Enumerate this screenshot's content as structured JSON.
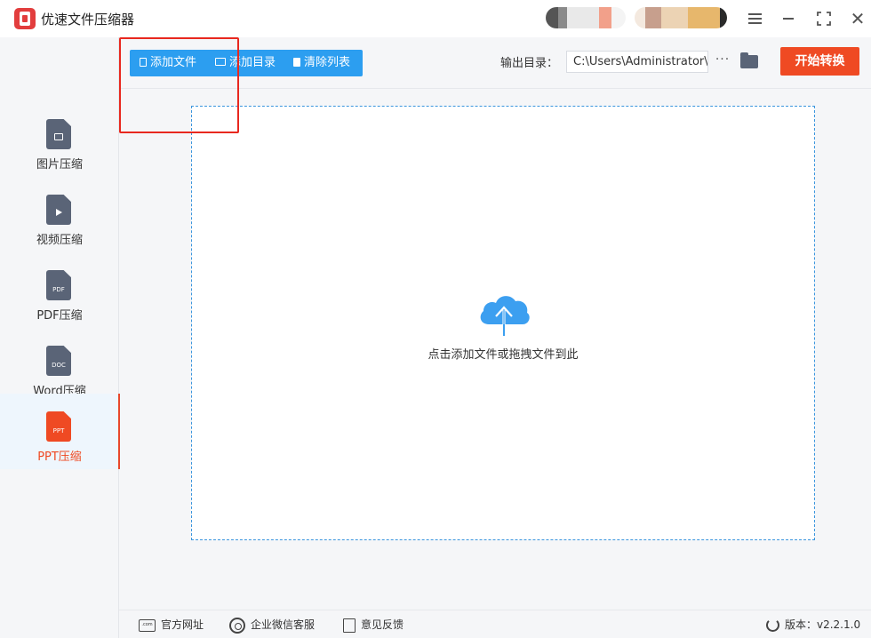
{
  "app": {
    "title": "优速文件压缩器"
  },
  "window": {
    "menu_icon": "menu-icon",
    "minimize_icon": "minimize-icon",
    "maximize_icon": "maximize-icon",
    "close_glyph": "✕"
  },
  "sidebar": {
    "items": [
      {
        "label": "图片压缩",
        "icon": "image-file-icon",
        "tag": ""
      },
      {
        "label": "视频压缩",
        "icon": "video-file-icon",
        "tag": ""
      },
      {
        "label": "PDF压缩",
        "icon": "pdf-file-icon",
        "tag": "PDF"
      },
      {
        "label": "Word压缩",
        "icon": "doc-file-icon",
        "tag": "DOC"
      },
      {
        "label": "PPT压缩",
        "icon": "ppt-file-icon",
        "tag": "PPT",
        "active": true
      }
    ]
  },
  "toolbar": {
    "add_file": "添加文件",
    "add_folder": "添加目录",
    "clear_list": "清除列表",
    "output_label": "输出目录：",
    "output_path": "C:\\Users\\Administrator\\",
    "more": "···",
    "start": "开始转换"
  },
  "dropzone": {
    "text": "点击添加文件或拖拽文件到此"
  },
  "footer": {
    "website": "官方网址",
    "wechat": "企业微信客服",
    "feedback": "意见反馈",
    "version": "版本：v2.2.1.0",
    "web_icon_text": ".com"
  },
  "colors": {
    "accent": "#2c9ef0",
    "start": "#ef4a23",
    "active": "#ef4a23",
    "highlight": "#e8281f"
  }
}
